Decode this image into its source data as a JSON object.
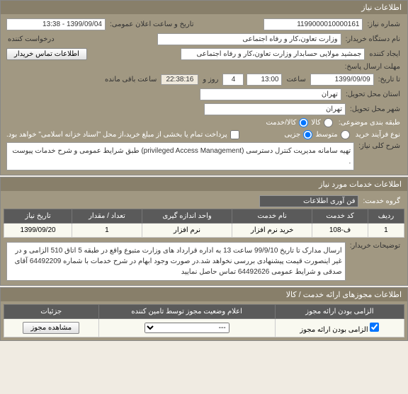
{
  "panel1": {
    "title": "اطلاعات نیاز",
    "need_number_label": "شماره نیاز:",
    "need_number": "1199000010000161",
    "announce_label": "تاریخ و ساعت اعلان عمومی:",
    "announce_value": "1399/09/04 - 13:38",
    "buyer_org_label": "نام دستگاه خریدار:",
    "buyer_org": "وزارت تعاون،کار و رفاه اجتماعی",
    "requester_label": "درخواست کننده",
    "creator_label": "ایجاد کننده",
    "creator": "جمشید مولایی حسابدار وزارت تعاون،کار و رفاه اجتماعی",
    "contact_btn": "اطلاعات تماس خریدار",
    "deadline_label": "مهلت ارسال پاسخ:",
    "date_label": "تا تاریخ:",
    "date_value": "1399/09/09",
    "time_label": "ساعت",
    "time_value": "13:00",
    "days_value": "4",
    "days_label": "روز و",
    "timer_value": "22:38:16",
    "remaining_label": "ساعت باقی مانده",
    "delivery_province_label": "استان محل تحویل:",
    "delivery_province": "تهران",
    "delivery_city_label": "شهر محل تحویل:",
    "delivery_city": "تهران",
    "category_label": "طبقه بندی موضوعی:",
    "radio_goods": "کالا",
    "radio_goods_service": "کالا/خدمت",
    "radio_medium": "متوسط",
    "purchase_type_label": "نوع فرآیند خرید",
    "radio_partial": "جزیی",
    "payment_note": "پرداخت تمام یا بخشی از مبلغ خرید،از محل \"اسناد خزانه اسلامی\" خواهد بود.",
    "general_desc_label": "شرح کلی نیاز:",
    "general_desc": "تهیه سامانه مدیریت کنترل دسترسی (privileged Access Management) طبق شرایط عمومی و شرح خدمات پیوست ."
  },
  "panel2": {
    "title": "اطلاعات خدمات مورد نیاز",
    "service_group_label": "گروه خدمت:",
    "service_group": "فن آوری اطلاعات",
    "table": {
      "headers": [
        "ردیف",
        "کد خدمت",
        "نام خدمت",
        "واحد اندازه گیری",
        "تعداد / مقدار",
        "تاریخ نیاز"
      ],
      "rows": [
        [
          "1",
          "ف-108",
          "خرید نرم افزار",
          "نرم افزار",
          "1",
          "1399/09/20"
        ]
      ]
    },
    "buyer_notes_label": "توضیحات خریدار:",
    "buyer_notes": "ارسال مدارک تا تاریخ 99/9/10 ساعت 13 به اداره قرارداد های وزارت متبوع واقع در طبقه 5 اتاق 510 الزامی و در غیر اینصورت قیمت پیشنهادی بررسی نخواهد شد.در صورت وجود ابهام در شرح خدمات با شماره 64492209 آقای صدقی و شرایط عمومی 64492626 تماس حاصل نمایید"
  },
  "panel3": {
    "title": "اطلاعات مجوزهای ارائه خدمت / کالا",
    "table": {
      "headers": [
        "الزامی بودن ارائه مجوز",
        "اعلام وضعیت مجوز توسط تامین کننده",
        "جزئیات"
      ],
      "rows": [
        [
          "الزامی بودن ارائه مجوز",
          "---",
          "مشاهده مجوز"
        ]
      ]
    }
  }
}
